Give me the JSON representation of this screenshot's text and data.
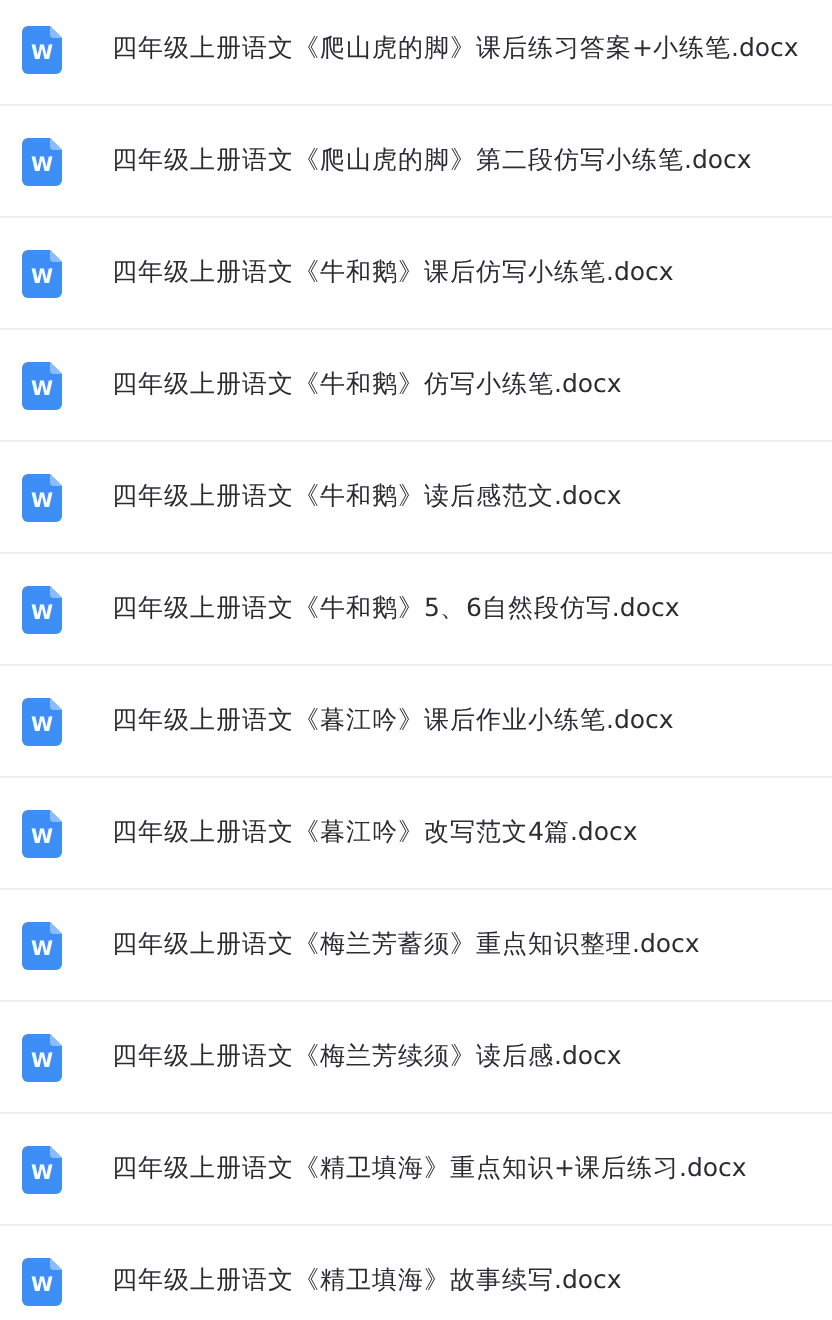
{
  "files": [
    {
      "icon": "W",
      "name": "四年级上册语文《爬山虎的脚》课后练习答案+小练笔.docx"
    },
    {
      "icon": "W",
      "name": "四年级上册语文《爬山虎的脚》第二段仿写小练笔.docx"
    },
    {
      "icon": "W",
      "name": "四年级上册语文《牛和鹅》课后仿写小练笔.docx"
    },
    {
      "icon": "W",
      "name": "四年级上册语文《牛和鹅》仿写小练笔.docx"
    },
    {
      "icon": "W",
      "name": "四年级上册语文《牛和鹅》读后感范文.docx"
    },
    {
      "icon": "W",
      "name": "四年级上册语文《牛和鹅》5、6自然段仿写.docx"
    },
    {
      "icon": "W",
      "name": "四年级上册语文《暮江吟》课后作业小练笔.docx"
    },
    {
      "icon": "W",
      "name": "四年级上册语文《暮江吟》改写范文4篇.docx"
    },
    {
      "icon": "W",
      "name": "四年级上册语文《梅兰芳蓄须》重点知识整理.docx"
    },
    {
      "icon": "W",
      "name": "四年级上册语文《梅兰芳续须》读后感.docx"
    },
    {
      "icon": "W",
      "name": "四年级上册语文《精卫填海》重点知识+课后练习.docx"
    },
    {
      "icon": "W",
      "name": "四年级上册语文《精卫填海》故事续写.docx"
    }
  ]
}
